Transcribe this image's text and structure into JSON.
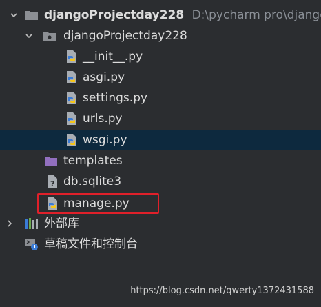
{
  "tree": {
    "project": {
      "name": "djangoProjectday228",
      "path": "D:\\pycharm pro\\django"
    },
    "package": {
      "name": "djangoProjectday228"
    },
    "files": [
      "__init__.py",
      "asgi.py",
      "settings.py",
      "urls.py",
      "wsgi.py"
    ],
    "templates": "templates",
    "db": "db.sqlite3",
    "manage": "manage.py",
    "external_libs": "外部库",
    "scratches": "草稿文件和控制台"
  },
  "watermark": "https://blog.csdn.net/qwerty1372431588",
  "colors": {
    "selection": "#0d293e",
    "highlight_box": "#e0202a",
    "folder": "#8c8f94",
    "templates_folder": "#9270bf"
  }
}
